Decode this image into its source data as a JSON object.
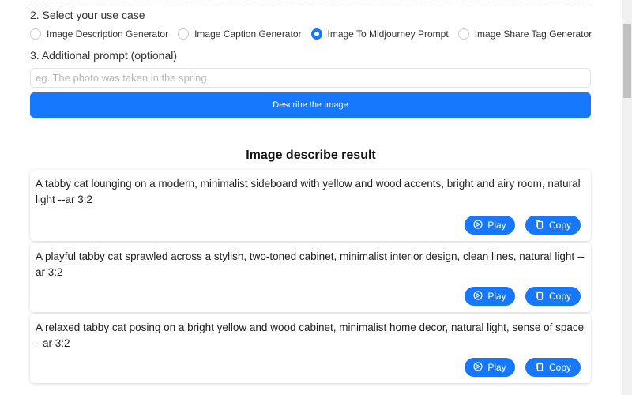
{
  "step2": {
    "label": "2. Select your use case",
    "options": [
      {
        "label": "Image Description Generator",
        "selected": false
      },
      {
        "label": "Image Caption Generator",
        "selected": false
      },
      {
        "label": "Image To Midjourney Prompt",
        "selected": true
      },
      {
        "label": "Image Share Tag Generator",
        "selected": false
      }
    ]
  },
  "step3": {
    "label": "3. Additional prompt (optional)",
    "placeholder": "eg. The photo was taken in the spring",
    "value": ""
  },
  "describe_button": "Describe the Image",
  "result": {
    "title": "Image describe result",
    "play_label": "Play",
    "copy_label": "Copy",
    "items": [
      "A tabby cat lounging on a modern, minimalist sideboard with yellow and wood accents, bright and airy room, natural light --ar 3:2",
      "A playful tabby cat sprawled across a stylish, two-toned cabinet, minimalist interior design, clean lines, natural light --ar 3:2",
      "A relaxed tabby cat posing on a bright yellow and wood cabinet, minimalist home decor, natural light, sense of space --ar 3:2"
    ]
  },
  "colors": {
    "accent": "#1677ff"
  }
}
